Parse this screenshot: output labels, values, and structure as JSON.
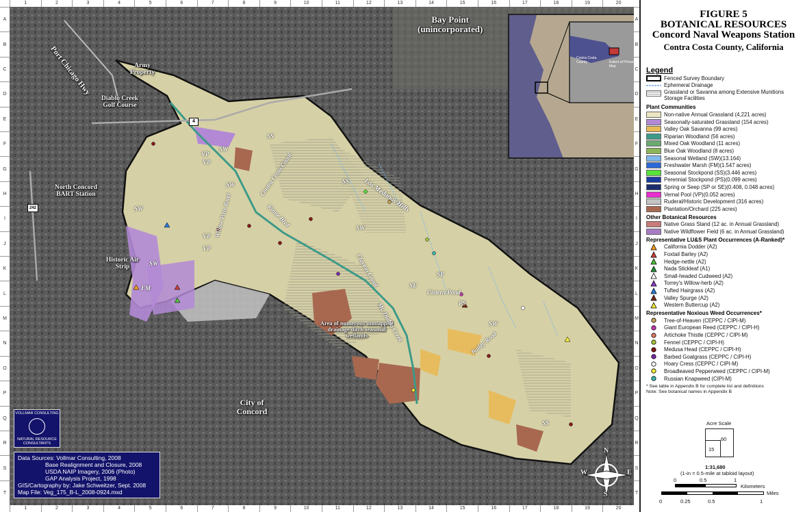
{
  "grid": {
    "columns": [
      "1",
      "2",
      "3",
      "4",
      "5",
      "6",
      "7",
      "8",
      "9",
      "10",
      "11",
      "12",
      "13",
      "14",
      "15",
      "16",
      "17",
      "18",
      "19",
      "20"
    ],
    "rows": [
      "A",
      "B",
      "C",
      "D",
      "E",
      "F",
      "G",
      "H",
      "I",
      "J",
      "K",
      "L",
      "M",
      "N",
      "O",
      "P",
      "Q",
      "R",
      "S",
      "T"
    ]
  },
  "map_labels": {
    "bay_point": "Bay Point",
    "bay_point_sub": "(unincorporated)",
    "port_chicago": "Port Chicago Hwy",
    "army": "Army Property",
    "diablo": "Diablo Creek Golf Course",
    "bart": "North Concord BART Station",
    "historic": "Historic Air Strip",
    "concord": "City of Concord",
    "drainage_note": "Area of numerous unmapped drainage ditch seasonal wetlands",
    "route4": "4",
    "route242": "242",
    "los_medanos": "Los Medanos Hills",
    "willow_pass": "Willow Pass Road",
    "kinne": "Kinne Blvd",
    "contra_canal": "Contra Costa Canal",
    "clayton": "Clayton Canal",
    "mt_diablo_creek": "Mt. Diablo Creek",
    "bailey": "Bailey Road",
    "cistern": "Cistern Pond",
    "sw": "SW",
    "vp": "VP",
    "ss": "SS",
    "fm": "FM",
    "se": "SE",
    "sp": "SP",
    "ps": "PS",
    "contra": "Contra"
  },
  "inset": {
    "label1": "Contra Costa County",
    "label2": "Extent of Primary Map"
  },
  "credits": [
    "Data Sources: Vollmar Consulting, 2008",
    "Base Realignment and Closure, 2008",
    "USDA NAIP Imagery, 2006 (Photo)",
    "GAP Analysis Project, 1998",
    "GIS/Cartography by: Jake Schweitzer, Sept. 2008",
    "Map File: Veg_175_B-L_2008-0924.mxd"
  ],
  "logo": {
    "line1": "VOLLMAR CONSULTING",
    "line2": "NATURAL RESOURCE CONSULTANTS"
  },
  "figure": {
    "title1": "FIGURE 5",
    "title2": "BOTANICAL RESOURCES",
    "title3": "Concord Naval Weapons Station",
    "subtitle": "Contra Costa County, California"
  },
  "legend": {
    "title": "Legend",
    "boundary": "Fenced Survey Boundary",
    "drainage": "Ephemeral Drainage",
    "grassland_munitions": "Grassland or Savanna among Extensive Munitions Storage Facilities",
    "communities_head": "Plant Communities",
    "communities": [
      {
        "label": "Non-native Annual Grassland (4,221 acres)",
        "color": "#ece6c2"
      },
      {
        "label": "Seasonally-saturated Grassland (154 acres)",
        "color": "#b389d6"
      },
      {
        "label": "Valley Oak Savanna (99 acres)",
        "color": "#e9b957"
      },
      {
        "label": "Riparian Woodland (56 acres)",
        "color": "#3d9a88"
      },
      {
        "label": "Mixed Oak Woodland (11 acres)",
        "color": "#6ba870"
      },
      {
        "label": "Blue Oak Woodland (8 acres)",
        "color": "#8bb558"
      },
      {
        "label": "Seasonal Wetland (SW)(13.164)",
        "color": "#7fb8ec"
      },
      {
        "label": "Freshwater Marsh (FM)(1.547 acres)",
        "color": "#2c69d6"
      },
      {
        "label": "Seasonal Stockpond (SS)(3.446 acres)",
        "color": "#56e33a"
      },
      {
        "label": "Perennial Stockpond (PS)(0.099 acres)",
        "color": "#1a3c9c"
      },
      {
        "label": "Spring or Seep (SP or SE)(0.408, 0.048 acres)",
        "color": "#1c2d6e"
      },
      {
        "label": "Vernal Pool (VP)(0.052 acres)",
        "color": "#e82ccf"
      },
      {
        "label": "Ruderal/Historic Development (316 acres)",
        "color": "#c3c3c3"
      },
      {
        "label": "Plantation/Orchard (225 acres)",
        "color": "#a86850"
      }
    ],
    "other_head": "Other Botanical Resources",
    "other": [
      {
        "label": "Native Grass Stand (12 ac. in Annual Grassland)",
        "color": "#c87a7a"
      },
      {
        "label": "Native Wildflower Field (6 ac. in Annual Grassland)",
        "color": "#a87cc4"
      }
    ],
    "plants_head": "Representative LU&S Plant Occurrences (A-Ranked)*",
    "plants": [
      {
        "label": "California Dodder (A2)",
        "color": "#f39a1e"
      },
      {
        "label": "Foxtail Barley (A2)",
        "color": "#c4413a"
      },
      {
        "label": "Hedge-nettle (A2)",
        "color": "#4fbf3a"
      },
      {
        "label": "Nada Stickleaf (A1)",
        "color": "#2a8f3a"
      },
      {
        "label": "Small-headed Cudweed (A2)",
        "color": "#ffffff"
      },
      {
        "label": "Torrey's Willow-herb (A2)",
        "color": "#8a3ec4"
      },
      {
        "label": "Tufted Hairgrass (A2)",
        "color": "#2c7ad6"
      },
      {
        "label": "Valley Spurge (A2)",
        "color": "#7a2a1c"
      },
      {
        "label": "Western Buttercup (A2)",
        "color": "#f2ea3a"
      }
    ],
    "weeds_head": "Representative Noxious Weed Occurrences*",
    "weeds": [
      {
        "label": "Tree-of-Heaven (CEPPC / CIPI-M)",
        "color": "#c8a25a"
      },
      {
        "label": "Giant European Reed (CEPPC / CIPI-H)",
        "color": "#c43ab0"
      },
      {
        "label": "Artichoke Thistle (CEPPC / CIPI-M)",
        "color": "#e07a6a"
      },
      {
        "label": "Fennel (CEPPC / CIPI-H)",
        "color": "#a8c83a"
      },
      {
        "label": "Medusa Head (CEPPC / CIPI-H)",
        "color": "#8a1a1a"
      },
      {
        "label": "Barbed Goatgrass (CEPPC / CIPI-H)",
        "color": "#7a2aa8"
      },
      {
        "label": "Hoary Cress (CEPPC / CIPI-M)",
        "color": "#ffffff"
      },
      {
        "label": "Broadleaved Pepperweed (CEPPC / CIPI-M)",
        "color": "#f2ea3a"
      },
      {
        "label": "Russian Knapweed (CIPI-M)",
        "color": "#3ab8b0"
      }
    ],
    "note1": "* See table in Appendix B for complete list and definitions",
    "note2": "Note: See botanical names in Appendix B"
  },
  "acre_scale": {
    "title": "Acre Scale",
    "large": "60",
    "small": "15"
  },
  "scale": {
    "ratio": "1:31,680",
    "desc": "(1-in = 0.5-mile at tabloid layout)",
    "km_labels": [
      "0",
      "0.5",
      "1"
    ],
    "km_unit": "Kilometers",
    "mi_labels": [
      "0",
      "0.25",
      "0.5",
      "1"
    ],
    "mi_unit": "Miles"
  },
  "north_arrow": {
    "n": "N",
    "s": "S",
    "e": "E",
    "w": "W"
  }
}
